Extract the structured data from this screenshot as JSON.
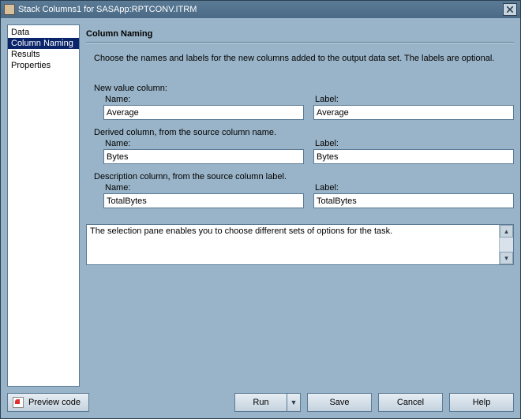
{
  "window": {
    "title": "Stack Columns1 for SASApp:RPTCONV.ITRM"
  },
  "sidebar": {
    "items": [
      {
        "label": "Data"
      },
      {
        "label": "Column Naming"
      },
      {
        "label": "Results"
      },
      {
        "label": "Properties"
      }
    ],
    "selected_index": 1
  },
  "content": {
    "heading": "Column Naming",
    "description": "Choose the names and labels for the new columns added to the output data set.  The labels are optional.",
    "sections": [
      {
        "title": "New value column:",
        "name_label": "Name:",
        "label_label": "Label:",
        "name_value": "Average",
        "label_value": "Average"
      },
      {
        "title": "Derived column, from the source column name.",
        "name_label": "Name:",
        "label_label": "Label:",
        "name_value": "Bytes",
        "label_value": "Bytes"
      },
      {
        "title": "Description column, from the source column label.",
        "name_label": "Name:",
        "label_label": "Label:",
        "name_value": "TotalBytes",
        "label_value": "TotalBytes"
      }
    ],
    "status_text": "The selection pane enables you to choose different sets of options for the task."
  },
  "buttons": {
    "preview": "Preview code",
    "run": "Run",
    "save": "Save",
    "cancel": "Cancel",
    "help": "Help"
  }
}
